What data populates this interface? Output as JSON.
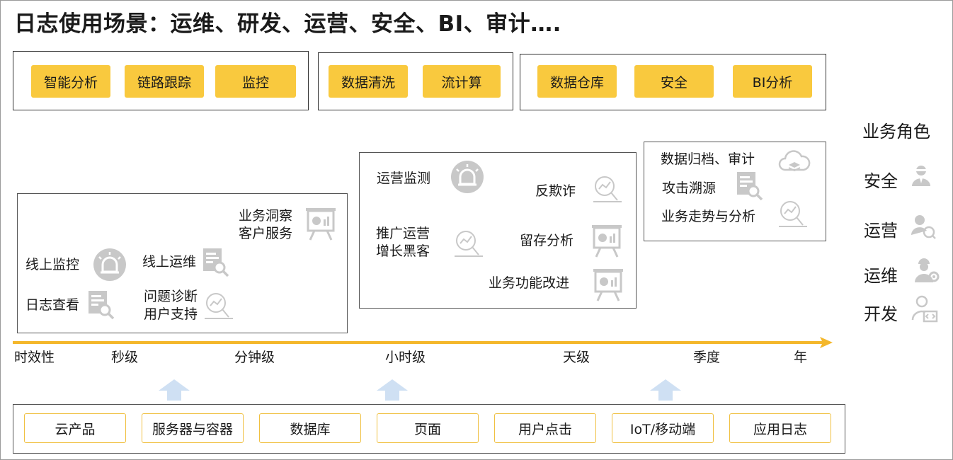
{
  "title": "日志使用场景：运维、研发、运营、安全、BI、审计….",
  "groups": [
    [
      "智能分析",
      "链路跟踪",
      "监控"
    ],
    [
      "数据清洗",
      "流计算"
    ],
    [
      "数据仓库",
      "安全",
      "BI分析"
    ]
  ],
  "box_left": {
    "insight": [
      "业务洞察",
      "客户服务"
    ],
    "online_monitor": "线上监控",
    "online_ops": "线上运维",
    "log_view": "日志查看",
    "diagnose": [
      "问题诊断",
      "用户支持"
    ]
  },
  "box_mid": {
    "ops_monitor": "运营监测",
    "anti_fraud": "反欺诈",
    "promo": [
      "推广运营",
      "增长黑客"
    ],
    "retention": "留存分析",
    "feature": "业务功能改进"
  },
  "box_right": {
    "archive": "数据归档、审计",
    "trace": "攻击溯源",
    "trend": "业务走势与分析"
  },
  "timeline": {
    "label": "时效性",
    "ticks": [
      "秒级",
      "分钟级",
      "小时级",
      "天级",
      "季度",
      "年"
    ]
  },
  "roles": {
    "title": "业务角色",
    "items": [
      "安全",
      "运营",
      "运维",
      "开发"
    ]
  },
  "sources": [
    "云产品",
    "服务器与容器",
    "数据库",
    "页面",
    "用户点击",
    "IoT/移动端",
    "应用日志"
  ],
  "colors": {
    "accent": "#f9c93e",
    "axis": "#f4b72b",
    "icon_gray": "#c8c8c8",
    "arrow_blue": "#cfe0f3"
  }
}
